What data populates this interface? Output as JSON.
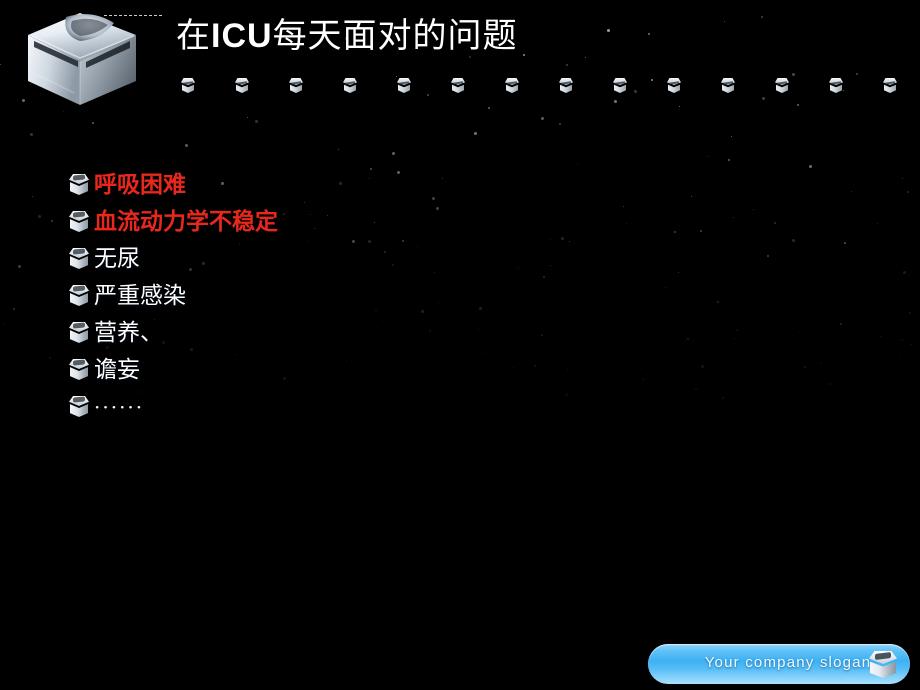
{
  "slide": {
    "background_top_color": "#05101a",
    "background_bottom_color": "#0092fa",
    "title_plain_before": "在",
    "title_emphasis": "ICU",
    "title_plain_after": "每天面对的问题",
    "title_full": "在ICU每天面对的问题"
  },
  "logo": {
    "icon_name": "metallic-cube-logo",
    "dash_line_name": "logo-dash-line"
  },
  "decoration": {
    "cube_row_icon": "mini-cube-icon",
    "cube_row_count": 14,
    "cube_row_positions": [
      10,
      64,
      118,
      172,
      226,
      280,
      334,
      388,
      442,
      496,
      550,
      604,
      658,
      712
    ],
    "star_count": 150
  },
  "bullets": [
    {
      "icon": "cube-bullet-icon",
      "text": "呼吸困难",
      "color": "#e8281c",
      "style": "red"
    },
    {
      "icon": "cube-bullet-icon",
      "text": "血流动力学不稳定",
      "color": "#e8281c",
      "style": "red"
    },
    {
      "icon": "cube-bullet-icon",
      "text": "无尿",
      "color": "#ffffff",
      "style": "white"
    },
    {
      "icon": "cube-bullet-icon",
      "text": "严重感染",
      "color": "#ffffff",
      "style": "white"
    },
    {
      "icon": "cube-bullet-icon",
      "text": "营养、",
      "color": "#ffffff",
      "style": "white"
    },
    {
      "icon": "cube-bullet-icon",
      "text": "谵妄",
      "color": "#ffffff",
      "style": "white"
    },
    {
      "icon": "cube-bullet-icon",
      "text": "······",
      "color": "#ffffff",
      "style": "dots"
    }
  ],
  "footer": {
    "slogan": "Your company slogan",
    "icon_name": "cube-icon",
    "pill_color": "#3cb1f3"
  }
}
